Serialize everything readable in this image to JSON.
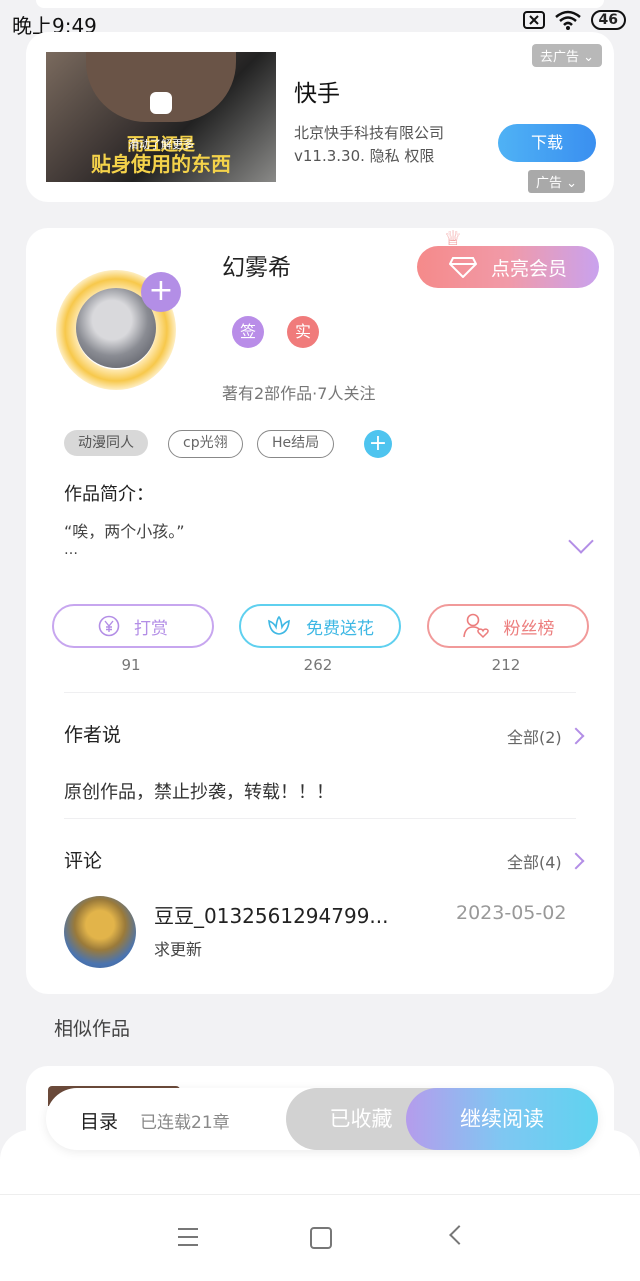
{
  "status_bar": {
    "time": "晚上9:49",
    "battery": "46"
  },
  "ad": {
    "image_caption_hint": "滑动了解更多",
    "image_caption_1": "而且还是",
    "image_caption_2": "贴身使用的东西",
    "title": "快手",
    "company": "北京快手科技有限公司",
    "version_line": "v11.3.30.  隐私  权限",
    "close_label": "去广告 ⌄",
    "download_label": "下载",
    "ad_tag": "广告 ⌄"
  },
  "author": {
    "name": "幻雾希",
    "vip_label": "点亮会员",
    "badge_sign": "签",
    "badge_real": "实",
    "stats": "著有2部作品·7人关注",
    "tags": [
      "动漫同人",
      "cp光翎",
      "He结局"
    ],
    "intro_label": "作品简介：",
    "intro_text": "“唉，两个小孩。”",
    "intro_more": "…"
  },
  "actions": [
    {
      "label": "打赏",
      "count": "91"
    },
    {
      "label": "免费送花",
      "count": "262"
    },
    {
      "label": "粉丝榜",
      "count": "212"
    }
  ],
  "author_says": {
    "title": "作者说",
    "all_label": "全部(2)",
    "text": "原创作品，禁止抄袭，转载！！！"
  },
  "comments": {
    "title": "评论",
    "all_label": "全部(4)",
    "items": [
      {
        "user": "豆豆_0132561294799...",
        "date": "2023-05-02",
        "text": "求更新"
      }
    ]
  },
  "similar": {
    "title": "相似作品"
  },
  "read_bar": {
    "toc_label": "目录",
    "chapters_label": "已连载21章",
    "collected_label": "已收藏",
    "continue_label": "继续阅读"
  }
}
